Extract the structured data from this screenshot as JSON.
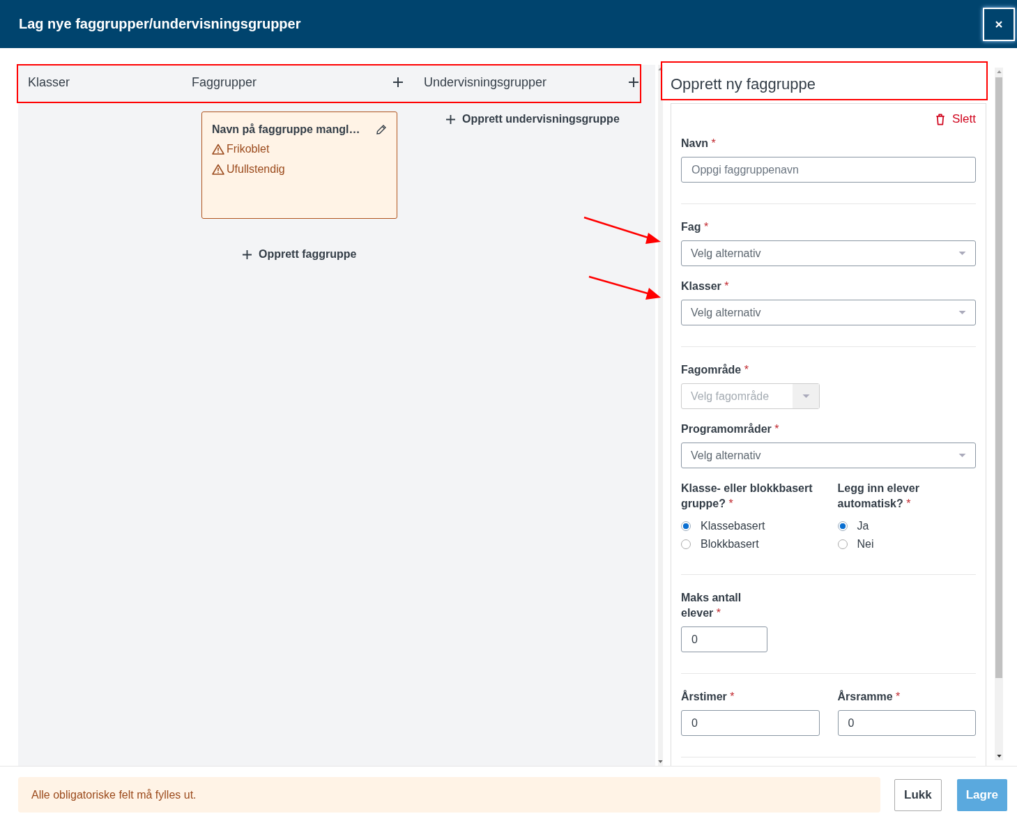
{
  "dialog": {
    "title": "Lag nye faggrupper/undervisningsgrupper"
  },
  "columns": [
    {
      "label": "Klasser",
      "add": false
    },
    {
      "label": "Faggrupper",
      "add": true
    },
    {
      "label": "Undervisningsgrupper",
      "add": true
    }
  ],
  "faggrupper": [
    {
      "name": "Navn på faggruppe mangl…",
      "warnings": [
        "Frikoblet",
        "Ufullstendig"
      ]
    }
  ],
  "create_faggruppe": "Opprett faggruppe",
  "create_undervisningsgruppe": "Opprett undervisningsgruppe",
  "form": {
    "title": "Opprett ny faggruppe",
    "delete": "Slett",
    "sections": [
      [
        [
          {
            "kind": "text",
            "label": "Navn",
            "mark": "*",
            "placeholder": "Oppgi faggruppenavn"
          }
        ]
      ],
      [
        [
          {
            "kind": "select",
            "label": "Fag",
            "mark": "*",
            "placeholder": "Velg alternativ",
            "disabled": false
          }
        ],
        [
          {
            "kind": "select",
            "label": "Klasser",
            "mark": "*",
            "placeholder": "Velg alternativ",
            "disabled": false
          }
        ]
      ],
      [
        [
          {
            "kind": "select",
            "label": "Fagområde",
            "mark": "*",
            "placeholder": "Velg fagområde",
            "disabled": true
          }
        ],
        [
          {
            "kind": "select",
            "label": "Programområder",
            "mark": "*",
            "placeholder": "Velg alternativ",
            "disabled": false
          }
        ],
        [
          {
            "kind": "radio",
            "label": "Klasse- eller blokkbasert gruppe?",
            "mark": "*",
            "options": [
              {
                "label": "Klassebasert",
                "selected": true
              },
              {
                "label": "Blokkbasert",
                "selected": false
              }
            ]
          },
          {
            "kind": "radio",
            "label": "Legg inn elever automatisk?",
            "mark": "*",
            "options": [
              {
                "label": "Ja",
                "selected": true
              },
              {
                "label": "Nei",
                "selected": false
              }
            ]
          }
        ]
      ],
      [
        [
          {
            "kind": "short-number",
            "label": "Maks antall elever",
            "mark": "*",
            "value": "0"
          }
        ]
      ],
      [
        [
          {
            "kind": "number",
            "label": "Årstimer",
            "mark": "*",
            "value": "0"
          },
          {
            "kind": "number",
            "label": "Årsramme",
            "mark": "*",
            "value": "0"
          }
        ]
      ]
    ]
  },
  "footer": {
    "message": "Alle obligatoriske felt må fylles ut.",
    "buttons": [
      {
        "label": "Lukk",
        "kind": "secondary"
      },
      {
        "label": "Lagre",
        "kind": "primary"
      }
    ]
  }
}
